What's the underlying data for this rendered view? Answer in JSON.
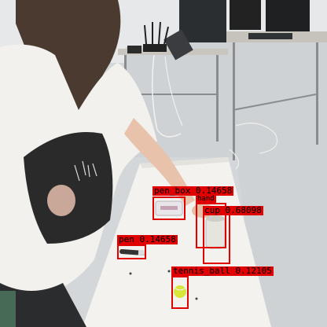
{
  "detections": [
    {
      "name": "pen-box-detection",
      "label": "pen_box 0.14658"
    },
    {
      "name": "hand-detection",
      "label": "hand"
    },
    {
      "name": "cup-detection",
      "label": "cup 0.68098"
    },
    {
      "name": "pen-detection",
      "label": "pen 0.14658"
    },
    {
      "name": "tennis-ball-detection",
      "label": "tennis_ball 0.12105"
    }
  ],
  "colors": {
    "box": "#e00000",
    "label_text": "#000000"
  }
}
